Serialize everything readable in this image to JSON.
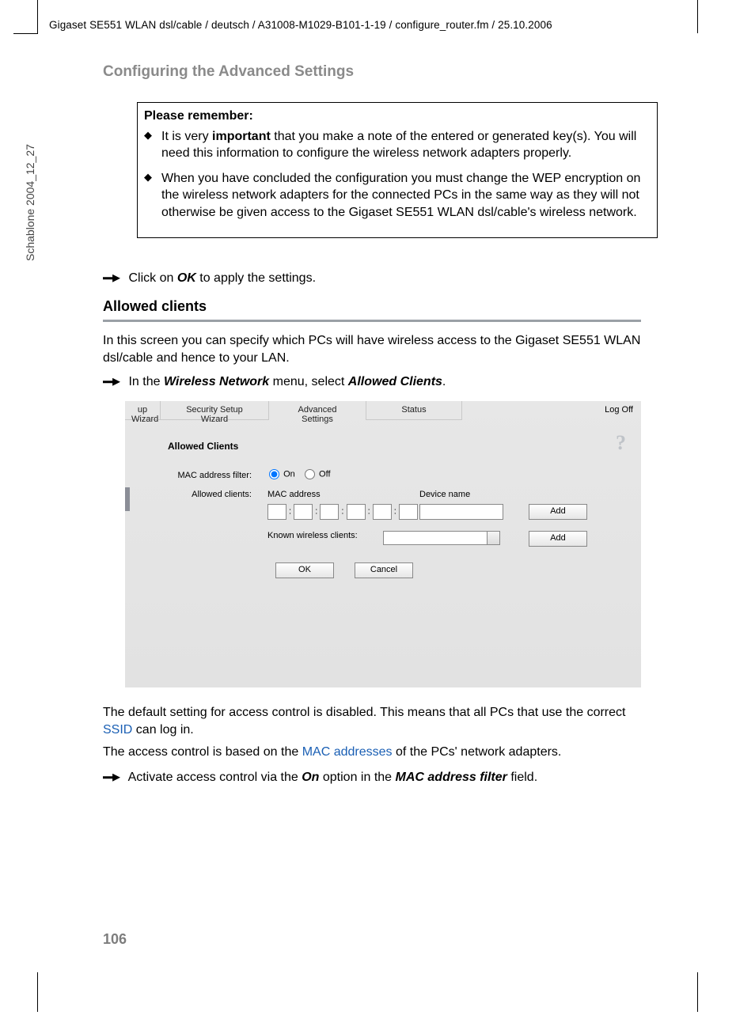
{
  "header": "Gigaset SE551 WLAN dsl/cable / deutsch / A31008-M1029-B101-1-19 / configure_router.fm / 25.10.2006",
  "side": "Schablone 2004_12_27",
  "section_title": "Configuring the Advanced Settings",
  "note": {
    "title": "Please remember:",
    "b1_pre": "It is very ",
    "b1_strong": "important",
    "b1_post": " that you make a note of the entered or generated key(s). You will need this information to configure the wireless network adapters properly.",
    "b2": "When you have concluded the configuration you must change the WEP encryption on the wireless network adapters for the connected PCs in the same way as they will not otherwise be given access to the Gigaset SE551 WLAN dsl/cable's wireless network."
  },
  "click_ok_pre": "Click on ",
  "click_ok_strong": "OK",
  "click_ok_post": " to apply the settings.",
  "subheading": "Allowed clients",
  "intro": "In this screen you can specify which PCs will have wireless access to the Gigaset SE551 WLAN dsl/cable and hence to your LAN.",
  "nav_pre": "In the ",
  "nav_strong1": "Wireless Network",
  "nav_mid": " menu, select ",
  "nav_strong2": "Allowed Clients",
  "nav_post": ".",
  "ui": {
    "tabs": {
      "t1": "up Wizard",
      "t2": "Security Setup Wizard",
      "t3": "Advanced Settings",
      "t4": "Status"
    },
    "logoff": "Log Off",
    "panel_title": "Allowed Clients",
    "lbl_filter": "MAC address filter:",
    "opt_on": "On",
    "opt_off": "Off",
    "lbl_allowed": "Allowed clients:",
    "col_mac": "MAC address",
    "col_dev": "Device name",
    "lbl_known": "Known wireless clients:",
    "btn_add": "Add",
    "btn_ok": "OK",
    "btn_cancel": "Cancel",
    "help": "?"
  },
  "after1_a": "The default setting for access control is disabled. This means that all PCs that use the correct ",
  "after1_link": "SSID",
  "after1_b": " can log in.",
  "after2_a": "The access control is based on the ",
  "after2_link": "MAC addresses",
  "after2_b": " of the PCs' network adapters.",
  "after3_pre": "Activate access control via the ",
  "after3_s1": "On",
  "after3_mid": " option in the ",
  "after3_s2": "MAC address filter",
  "after3_post": " field.",
  "page_num": "106"
}
